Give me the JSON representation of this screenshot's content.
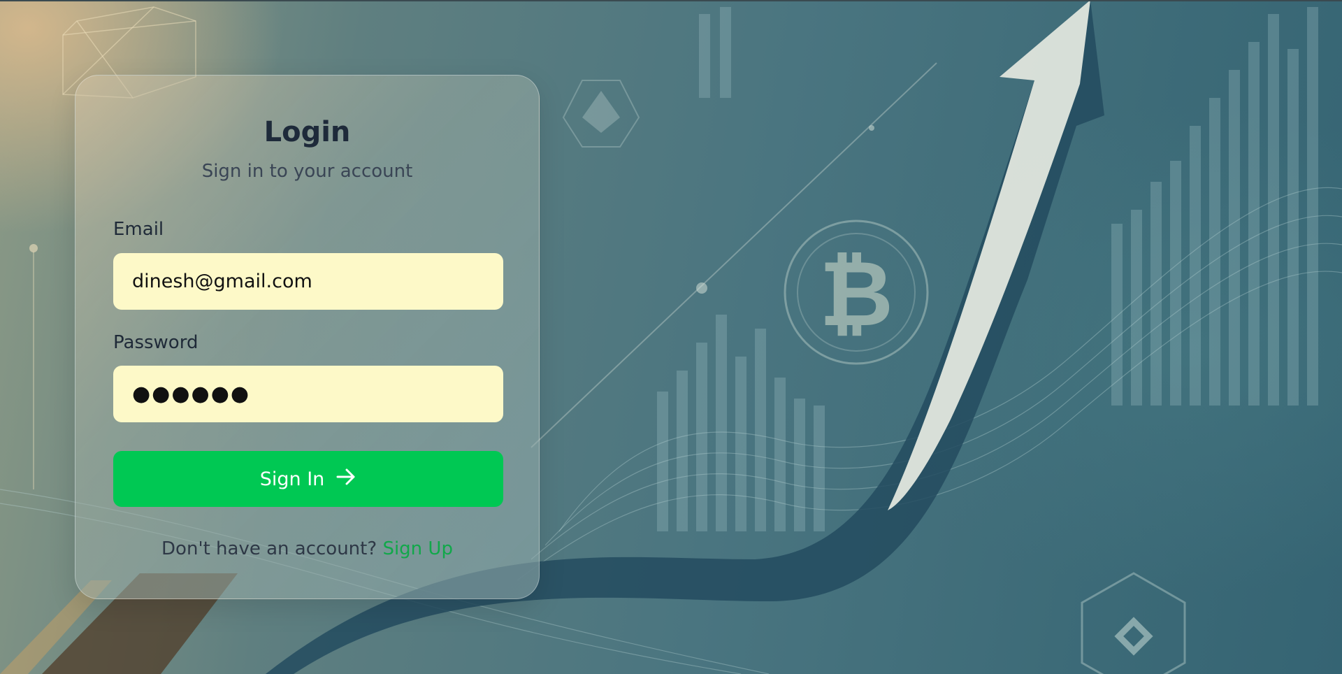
{
  "login": {
    "title": "Login",
    "subtitle": "Sign in to your account",
    "email_label": "Email",
    "email_value": "dinesh@gmail.com",
    "password_label": "Password",
    "password_value": "●●●●●●",
    "signin_label": "Sign In",
    "footer_text": "Don't have an account?",
    "signup_label": "Sign Up"
  },
  "colors": {
    "accent": "#00c853",
    "input_bg": "#fdf9c8",
    "link": "#11a84a"
  },
  "icons": {
    "signin_icon": "arrow-right-icon",
    "background_coins": [
      "bitcoin-icon",
      "ethereum-icon",
      "binance-icon"
    ]
  }
}
